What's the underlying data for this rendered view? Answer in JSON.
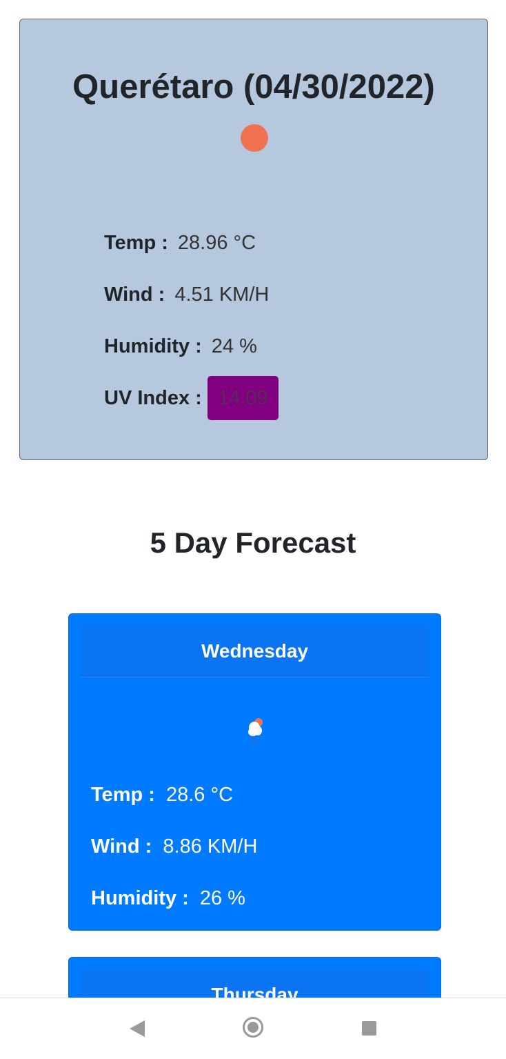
{
  "current": {
    "title": "Querétaro (04/30/2022)",
    "weather_icon": "sun-icon",
    "temp_label": "Temp :",
    "temp_value": "28.96 °C",
    "wind_label": "Wind :",
    "wind_value": "4.51 KM/H",
    "humidity_label": "Humidity :",
    "humidity_value": "24 %",
    "uv_label": "UV Index :",
    "uv_value": "14.09",
    "uv_color": "#800080"
  },
  "forecast": {
    "heading": "5 Day Forecast",
    "days": [
      {
        "day": "Wednesday",
        "icon": "cloud-sun-rain-icon",
        "temp_label": "Temp :",
        "temp_value": "28.6 °C",
        "wind_label": "Wind :",
        "wind_value": "8.86 KM/H",
        "humidity_label": "Humidity :",
        "humidity_value": "26 %"
      },
      {
        "day": "Thursday"
      }
    ]
  },
  "colors": {
    "current_card_bg": "#b5c8dd",
    "forecast_card_bg": "#007bff"
  },
  "nav": {
    "back_icon": "back-icon",
    "home_icon": "home-icon",
    "recents_icon": "recents-icon"
  }
}
